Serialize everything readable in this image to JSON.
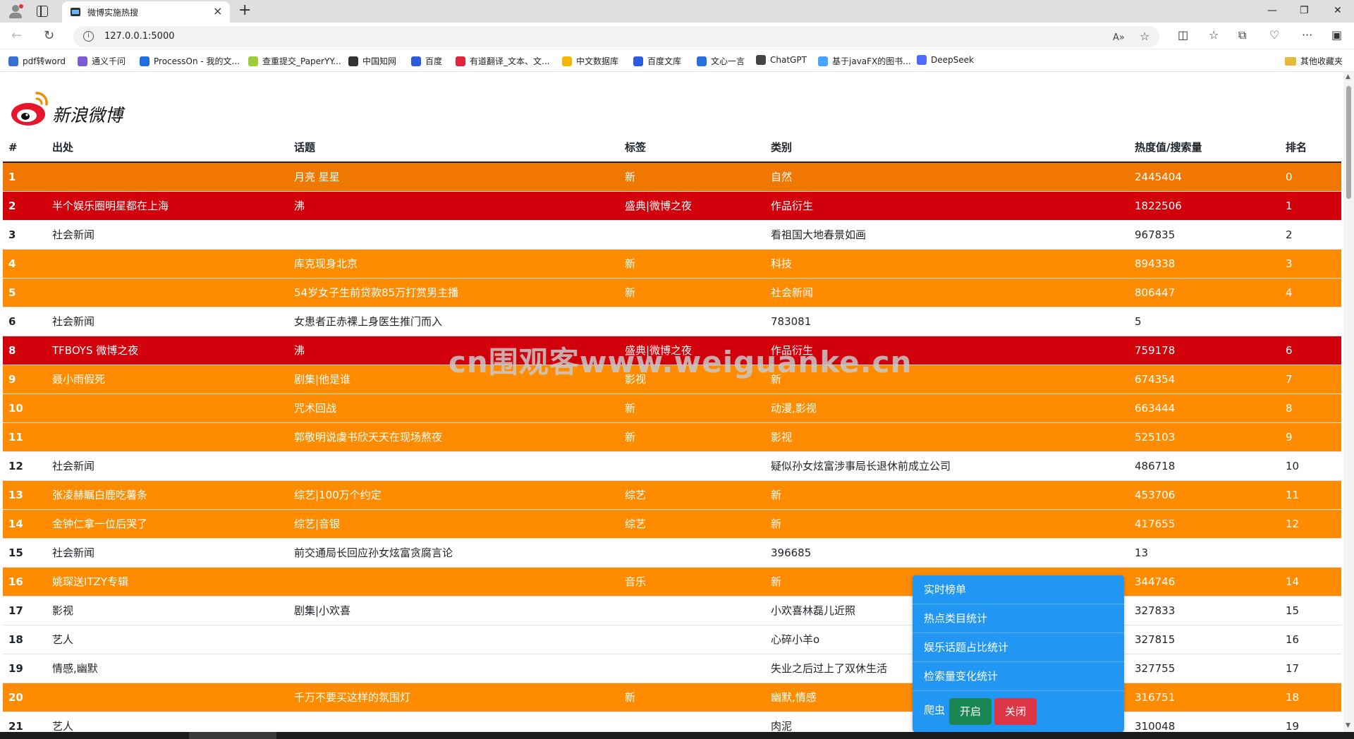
{
  "browser": {
    "tab_title": "微博实施热搜",
    "tab_close": "×",
    "new_tab": "+",
    "url": "127.0.0.1:5000",
    "win_min": "—",
    "win_max": "❐",
    "win_close": "✕",
    "bookmarks": [
      {
        "label": "pdf转word",
        "color": "#3b6fd8"
      },
      {
        "label": "通义千问",
        "color": "#7b5cd6"
      },
      {
        "label": "ProcessOn - 我的文...",
        "color": "#1f6fe0"
      },
      {
        "label": "查重提交_PaperYY...",
        "color": "#9ccc3c"
      },
      {
        "label": "中国知网",
        "color": "#333333"
      },
      {
        "label": "百度",
        "color": "#2e5bdc"
      },
      {
        "label": "有道翻译_文本、文...",
        "color": "#e0263a"
      },
      {
        "label": "中文数据库",
        "color": "#f2b705"
      },
      {
        "label": "百度文库",
        "color": "#2e5bdc"
      },
      {
        "label": "文心一言",
        "color": "#2a6fe0"
      },
      {
        "label": "ChatGPT",
        "color": "#444444"
      },
      {
        "label": "基于javaFX的图书...",
        "color": "#4aa3ff"
      },
      {
        "label": "DeepSeek",
        "color": "#4d6bfe"
      }
    ],
    "other_bookmarks": "其他收藏夹"
  },
  "page": {
    "logo_text": "新浪微博",
    "watermark": "cn围观客www.weiguanke.cn"
  },
  "table": {
    "headers": [
      "#",
      "出处",
      "话题",
      "标签",
      "类别",
      "热度值/搜索量",
      "排名"
    ],
    "rows": [
      {
        "style": "orange2",
        "cells": [
          "1",
          "",
          "月亮 星星",
          "新",
          "自然",
          "2445404",
          "0"
        ]
      },
      {
        "style": "red",
        "cells": [
          "2",
          "半个娱乐圈明星都在上海",
          "沸",
          "盛典|微博之夜",
          "作品衍生",
          "1822506",
          "1"
        ]
      },
      {
        "style": "white",
        "cells": [
          "3",
          "社会新闻",
          "",
          "",
          "看祖国大地春景如画",
          "967835",
          "2"
        ]
      },
      {
        "style": "orange",
        "cells": [
          "4",
          "",
          "库克现身北京",
          "新",
          "科技",
          "894338",
          "3"
        ]
      },
      {
        "style": "orange",
        "cells": [
          "5",
          "",
          "54岁女子生前贷款85万打赏男主播",
          "新",
          "社会新闻",
          "806447",
          "4"
        ]
      },
      {
        "style": "white",
        "cells": [
          "6",
          "社会新闻",
          "女患者正赤裸上身医生推门而入",
          "",
          "783081",
          "5",
          ""
        ]
      },
      {
        "style": "red",
        "cells": [
          "8",
          "TFBOYS 微博之夜",
          "沸",
          "盛典|微博之夜",
          "作品衍生",
          "759178",
          "6"
        ]
      },
      {
        "style": "orange",
        "cells": [
          "9",
          "聂小雨假死",
          "剧集|他是谁",
          "影视",
          "新",
          "674354",
          "7"
        ]
      },
      {
        "style": "orange",
        "cells": [
          "10",
          "",
          "咒术回战",
          "新",
          "动漫,影视",
          "663444",
          "8"
        ]
      },
      {
        "style": "orange",
        "cells": [
          "11",
          "",
          "郭敬明说虞书欣天天在现场熬夜",
          "新",
          "影视",
          "525103",
          "9"
        ]
      },
      {
        "style": "white",
        "cells": [
          "12",
          "社会新闻",
          "",
          "",
          "疑似孙女炫富涉事局长退休前成立公司",
          "486718",
          "10"
        ]
      },
      {
        "style": "orange",
        "cells": [
          "13",
          "张凌赫瞩白鹿吃薯条",
          "综艺|100万个约定",
          "综艺",
          "新",
          "453706",
          "11"
        ]
      },
      {
        "style": "orange",
        "cells": [
          "14",
          "金钟仁拿一位后哭了",
          "综艺|音银",
          "综艺",
          "新",
          "417655",
          "12"
        ]
      },
      {
        "style": "white",
        "cells": [
          "15",
          "社会新闻",
          "前交通局长回应孙女炫富贪腐言论",
          "",
          "396685",
          "13",
          ""
        ]
      },
      {
        "style": "orange",
        "cells": [
          "16",
          "姚琛送ITZY专辑",
          "",
          "音乐",
          "新",
          "344746",
          "14"
        ]
      },
      {
        "style": "white",
        "cells": [
          "17",
          "影视",
          "剧集|小欢喜",
          "",
          "小欢喜林磊儿近照",
          "327833",
          "15"
        ]
      },
      {
        "style": "white",
        "cells": [
          "18",
          "艺人",
          "",
          "",
          "心碎小羊o",
          "327815",
          "16"
        ]
      },
      {
        "style": "white",
        "cells": [
          "19",
          "情感,幽默",
          "",
          "",
          "失业之后过上了双休生活",
          "327755",
          "17"
        ]
      },
      {
        "style": "orange",
        "cells": [
          "20",
          "",
          "千万不要买这样的氛围灯",
          "新",
          "幽默,情感",
          "316751",
          "18"
        ]
      },
      {
        "style": "white",
        "cells": [
          "21",
          "艺人",
          "",
          "",
          "肉泥",
          "310048",
          "19"
        ]
      }
    ]
  },
  "menu": {
    "items": [
      "实时榜单",
      "热点类目统计",
      "娱乐话题占比统计",
      "检索量变化统计"
    ],
    "crawler_label": "爬虫",
    "start_label": "开启",
    "stop_label": "关闭"
  }
}
